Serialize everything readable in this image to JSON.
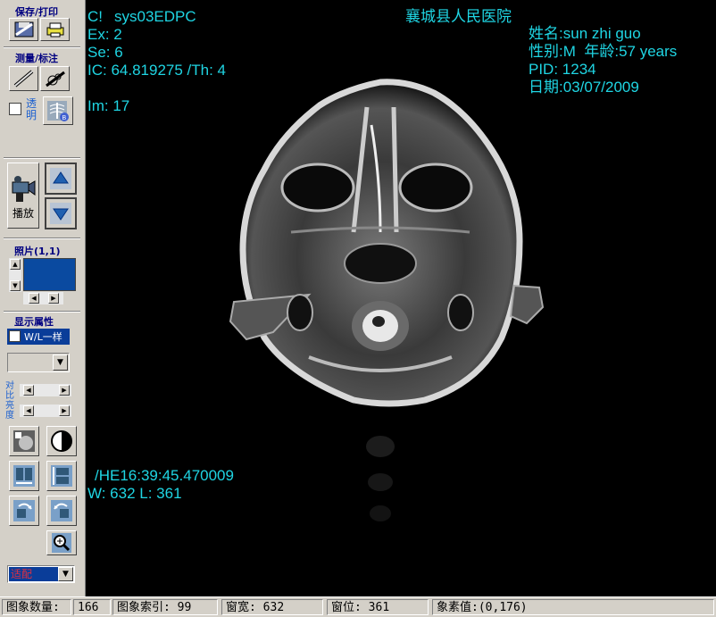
{
  "sidebar": {
    "save_print_title": "保存/打印",
    "measure_title": "测量/标注",
    "transparent_label": "透明",
    "play_label": "播放",
    "photo_title": "照片(1,1)",
    "display_title": "显示属性",
    "wl_checkbox_label": "W/L一样",
    "contrast_label": "对比",
    "brightness_label": "亮度",
    "fit_select_value": "适配"
  },
  "overlay": {
    "c_label": "C!",
    "station": "sys03EDPC",
    "ex": "Ex: 2",
    "se": "Se: 6",
    "ic": "IC: 64.819275 /Th: 4",
    "im": "Im: 17",
    "hospital": "襄城县人民医院",
    "name_label": "姓名",
    "name_value": "sun zhi guo",
    "sex_label": "性别",
    "sex_value": "M",
    "age_label": "年龄",
    "age_value": "57 years",
    "pid": "PID: 1234",
    "date_label": "日期",
    "date_value": "03/07/2009",
    "time": "/HE16:39:45.470009",
    "wl": "W: 632 L: 361"
  },
  "statusbar": {
    "image_count_label": "图象数量",
    "image_count": "166",
    "image_index_label": "图象索引",
    "image_index": "99",
    "window_width_label": "窗宽",
    "window_width": "632",
    "window_level_label": "窗位",
    "window_level": "361",
    "pixel_value_label": "象素值",
    "pixel_value": "(0,176)"
  },
  "colors": {
    "overlay_text": "#1fd5e3",
    "title_text": "#000080",
    "select_highlight": "#0a3d99",
    "photo_preview": "#0a4aa0"
  }
}
